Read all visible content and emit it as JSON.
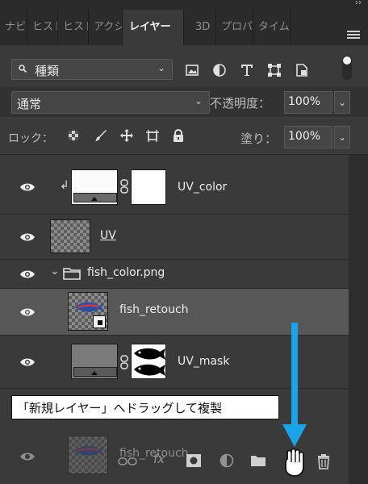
{
  "panel": {
    "tabs": [
      "ナビゲ",
      "ヒスト",
      "ヒスト",
      "アクシ",
      "レイヤー",
      "3D",
      "プロパ",
      "タイム"
    ],
    "menu_chevron": "››",
    "filter": {
      "kind_label": "種類",
      "icons": [
        "image-filter-icon",
        "adjustment-filter-icon",
        "type-filter-icon",
        "shape-filter-icon",
        "smartobject-filter-icon"
      ]
    },
    "blend_mode": "通常",
    "opacity_label": "不透明度：",
    "opacity_value": "100%",
    "lock_label": "ロック：",
    "fill_label": "塗り：",
    "fill_value": "100%"
  },
  "layers": [
    {
      "name": "UV_color",
      "type": "adjustment-with-mask",
      "clipped": true
    },
    {
      "name": "UV",
      "type": "pixel",
      "underlined": true
    },
    {
      "name": "fish_color.png",
      "type": "group",
      "expanded": true
    },
    {
      "name": "fish_retouch",
      "type": "smart-object",
      "selected": true
    },
    {
      "name": "UV_mask",
      "type": "adjustment-with-mask"
    }
  ],
  "drag_ghost": {
    "name": "fish_retouch"
  },
  "callout": {
    "text": "「新規レイヤー」へドラッグして複製"
  },
  "bottom_bar": {
    "icons": [
      "link-icon",
      "fx-icon",
      "mask-icon",
      "adjustment-icon",
      "folder-icon",
      "new-layer-icon",
      "trash-icon"
    ]
  },
  "colors": {
    "arrow": "#1aa3e8",
    "selected_row": "#575757",
    "panel": "#3a3a3a"
  }
}
